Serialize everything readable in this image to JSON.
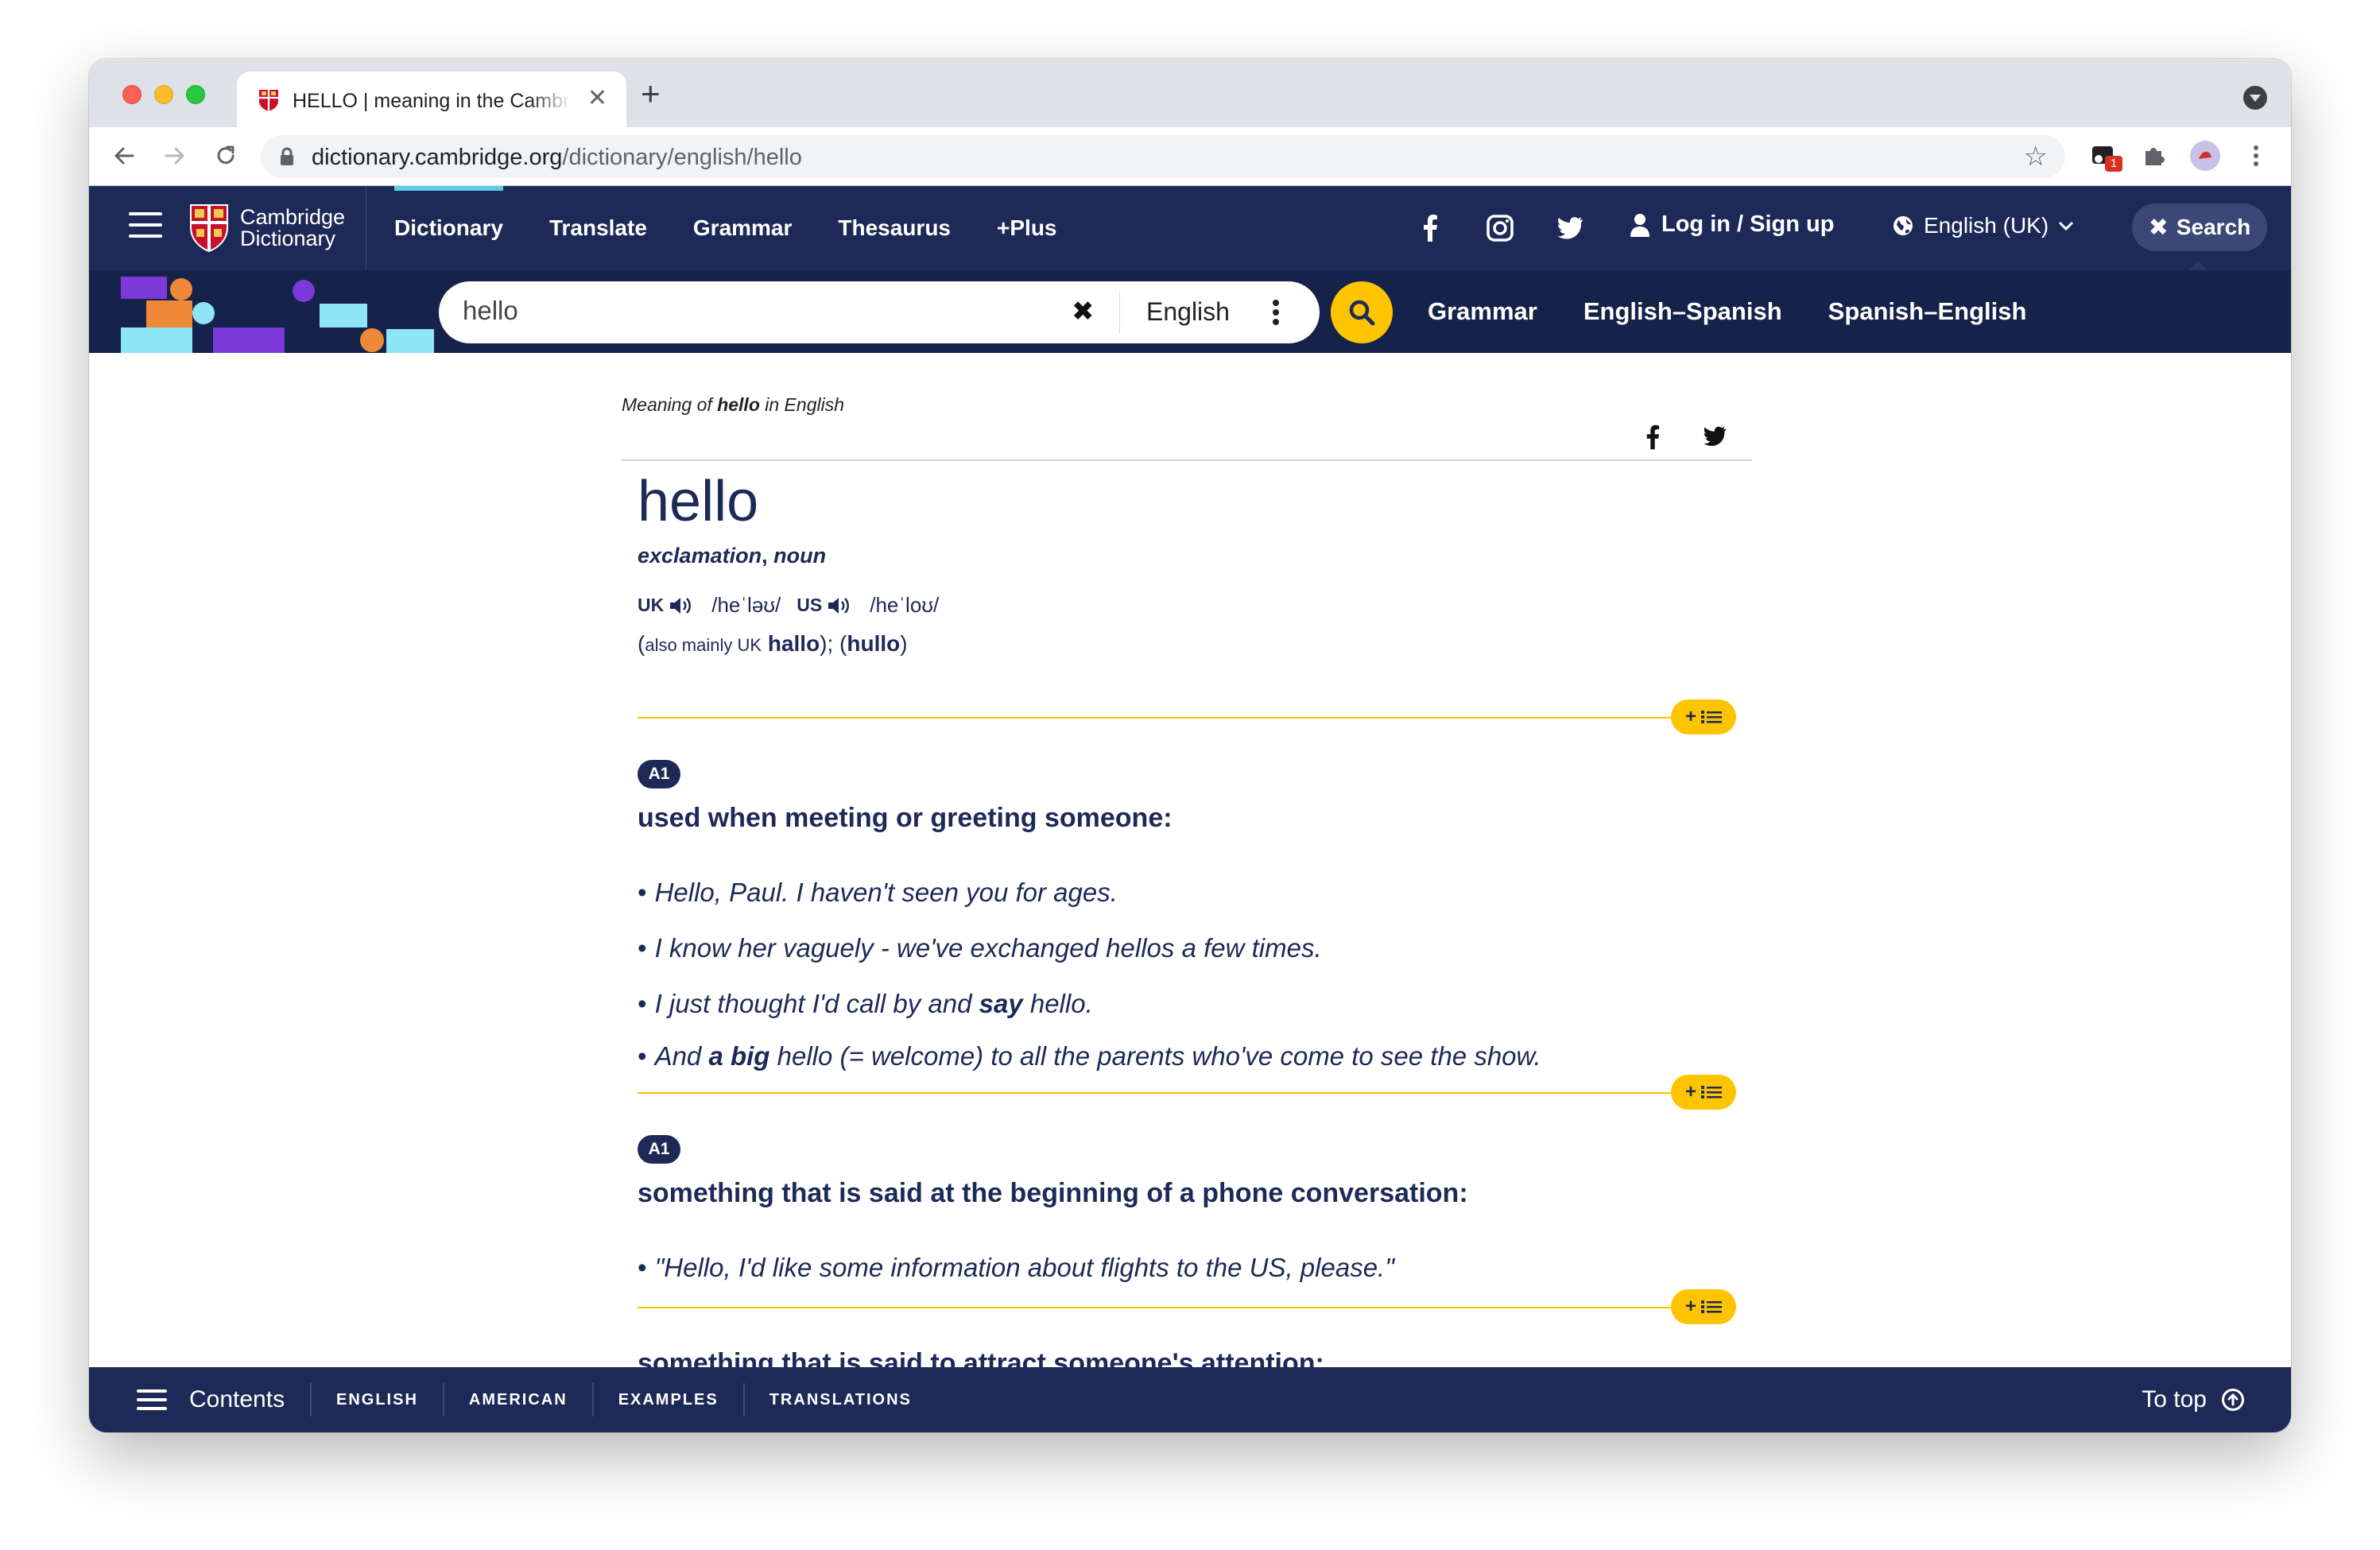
{
  "browser": {
    "tab_title": "HELLO | meaning in the Cambridge English Dictionary",
    "tab_close": "✕",
    "new_tab": "+",
    "url_host": "dictionary.cambridge.org",
    "url_path": "/dictionary/english/hello",
    "extension_badge": "1"
  },
  "header": {
    "brand_line1": "Cambridge",
    "brand_line2": "Dictionary",
    "nav": [
      "Dictionary",
      "Translate",
      "Grammar",
      "Thesaurus",
      "+Plus"
    ],
    "login_label": "Log in / Sign up",
    "language": "English (UK)",
    "search_button": "Search"
  },
  "search": {
    "query": "hello",
    "dictionary": "English",
    "links": [
      "Grammar",
      "English–Spanish",
      "Spanish–English"
    ]
  },
  "entry": {
    "meaning_prefix": "Meaning of ",
    "meaning_word": "hello",
    "meaning_suffix": " in English",
    "headword": "hello",
    "pos_1": "exclamation",
    "pos_sep": ", ",
    "pos_2": "noun",
    "uk_label": "UK",
    "uk_ipa": "/heˈləʊ/",
    "us_label": "US",
    "us_ipa": "/heˈloʊ/",
    "variants": {
      "open": "(",
      "note": "also mainly UK",
      "form1": "hallo",
      "mid": "); (",
      "form2": "hullo",
      "close": ")"
    },
    "sense_button": "+",
    "senses": [
      {
        "level": "A1",
        "definition": "used when meeting or greeting someone:",
        "examples": [
          {
            "pre": "Hello, Paul. I haven't seen you for ages."
          },
          {
            "pre": "I know her vaguely - we've exchanged hellos a few times."
          },
          {
            "pre": "I just thought I'd call by and ",
            "bold": "say",
            "post": " hello."
          },
          {
            "pre": "And ",
            "bold": "a big",
            "post": " hello (= welcome) to all the parents who've come to see the show."
          }
        ]
      },
      {
        "level": "A1",
        "definition": "something that is said at the beginning of a phone conversation:",
        "examples": [
          {
            "pre": "\"Hello, I'd like some information about flights to the US, please.\""
          }
        ]
      },
      {
        "definition": "something that is said to attract someone's attention:"
      }
    ]
  },
  "footer": {
    "contents": "Contents",
    "links": [
      "ENGLISH",
      "AMERICAN",
      "EXAMPLES",
      "TRANSLATIONS"
    ],
    "to_top": "To top"
  },
  "colors": {
    "navy": "#1d2a57",
    "navy_dark": "#152249",
    "accent_yellow": "#fec400",
    "accent_cyan": "#5acbe8"
  },
  "icons": [
    "cambridge-crest-icon",
    "back-icon",
    "forward-icon",
    "reload-icon",
    "lock-icon",
    "star-icon",
    "extension-icon",
    "puzzle-icon",
    "avatar",
    "kebab-icon",
    "facebook-icon",
    "instagram-icon",
    "twitter-icon",
    "user-icon",
    "globe-icon",
    "search-icon",
    "speaker-icon",
    "list-icon",
    "arrow-up-circle-icon"
  ]
}
